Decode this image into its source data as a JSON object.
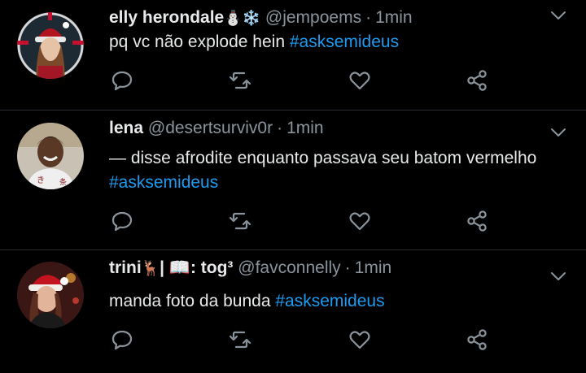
{
  "tweets": [
    {
      "name": "elly herondale",
      "name_emoji": "⛄❄️",
      "handle": "@jempoems",
      "separator": "·",
      "time": "1min",
      "text": "pq vc não explode hein ",
      "hashtag": "#asksemideus",
      "avatar_icon": "avatar-girl-red-hat"
    },
    {
      "name": "lena",
      "handle": "@desertsurviv0r",
      "separator": "·",
      "time": "1min",
      "text_line1": "— disse afrodite enquanto passava seu batom vermelho",
      "hashtag": "#asksemideus",
      "avatar_icon": "avatar-person-smiling"
    },
    {
      "name": "trini",
      "name_emoji": "🦌",
      "name_suffix": "| 📖: tog³",
      "handle": "@favconnelly",
      "separator": "·",
      "time": "1min",
      "text": "manda foto da bunda ",
      "hashtag": "#asksemideus",
      "avatar_icon": "avatar-girl-santa-hat"
    }
  ],
  "actions": [
    "reply-icon",
    "retweet-icon",
    "like-icon",
    "share-icon"
  ],
  "colors": {
    "background": "#000000",
    "text": "#e7e9ea",
    "secondary": "#8b949c",
    "hashtag": "#1d9bf0",
    "icon": "#8b949c",
    "divider": "#2a2e33"
  }
}
